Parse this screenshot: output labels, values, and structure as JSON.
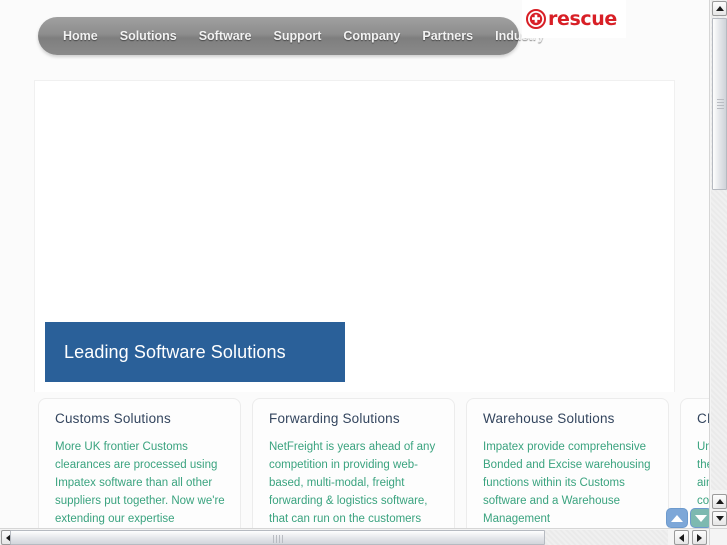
{
  "site": {
    "logo": {
      "text": "rescue",
      "icon": "red-cross-circle-icon",
      "color": "#d81f26"
    }
  },
  "nav": {
    "items": [
      {
        "label": "Home"
      },
      {
        "label": "Solutions"
      },
      {
        "label": "Software"
      },
      {
        "label": "Support"
      },
      {
        "label": "Company"
      },
      {
        "label": "Partners"
      },
      {
        "label": "Industry"
      }
    ]
  },
  "hero": {
    "headline": "Leading Software Solutions",
    "banner_color": "#2a6099"
  },
  "cards": [
    {
      "title": "Customs Solutions",
      "body": "More UK frontier Customs clearances are processed using Impatex software than all other suppliers put together. Now we're extending our expertise"
    },
    {
      "title": "Forwarding Solutions",
      "body": "NetFreight is years ahead of any competition in providing web-based, multi-modal, freight forwarding & logistics software, that can run on the customers"
    },
    {
      "title": "Warehouse Solutions",
      "body": "Impatex provide comprehensive Bonded and Excise warehousing functions within its Customs software and a Warehouse Management"
    },
    {
      "title": "CRM",
      "body": "Unlike other CRM packages on the market, NetFreight CRM is aimed at freight forwarding companies and"
    }
  ],
  "float_buttons": {
    "scroll_up": "scroll-up",
    "scroll_down": "scroll-down"
  },
  "scrollbars": {
    "vertical": {
      "up": "scroll-up",
      "down": "scroll-down"
    },
    "horizontal": {
      "left": "scroll-left",
      "right": "scroll-right"
    }
  },
  "colors": {
    "nav_bar": "#8d8d8d",
    "card_title": "#33455e",
    "card_body": "#3aa37f",
    "accent_blue": "#2a6099",
    "logo_red": "#d81f26"
  }
}
